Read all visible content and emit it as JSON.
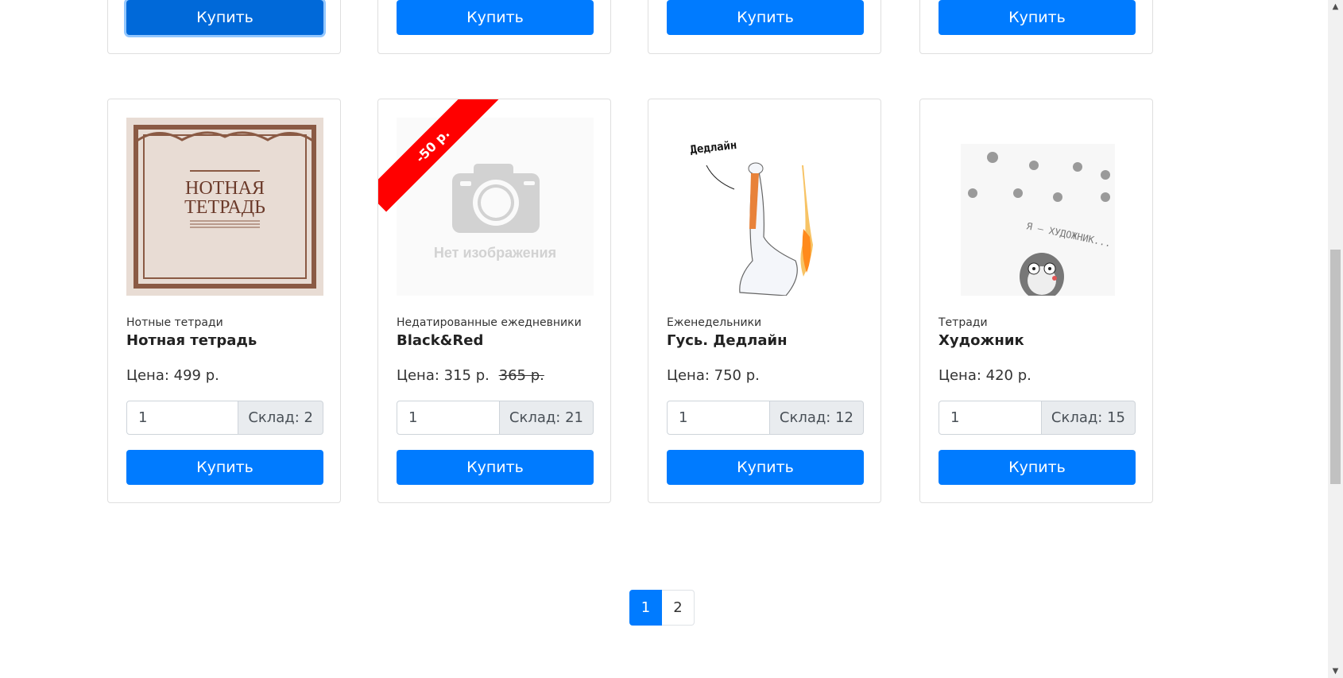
{
  "top_row": {
    "buttons": [
      "Купить",
      "Купить",
      "Купить",
      "Купить"
    ]
  },
  "products": [
    {
      "category": "Нотные тетради",
      "title": "Нотная тетрадь",
      "price_label": "Цена:",
      "price": "499 р.",
      "quantity": "1",
      "stock": "Склад: 2",
      "buy_label": "Купить",
      "cover_text_line1": "НОТНАЯ",
      "cover_text_line2": "ТЕТРАДЬ"
    },
    {
      "category": "Недатированные ежедневники",
      "title": "Black&Red",
      "price_label": "Цена:",
      "price": "315 р.",
      "old_price": "365 р.",
      "discount_badge": "-50 р.",
      "no_image_text": "Нет изображения",
      "quantity": "1",
      "stock": "Склад: 21",
      "buy_label": "Купить"
    },
    {
      "category": "Еженедельники",
      "title": "Гусь. Дедлайн",
      "price_label": "Цена:",
      "price": "750 р.",
      "quantity": "1",
      "stock": "Склад: 12",
      "buy_label": "Купить",
      "cover_caption": "Дедлайн"
    },
    {
      "category": "Тетради",
      "title": "Художник",
      "price_label": "Цена:",
      "price": "420 р.",
      "quantity": "1",
      "stock": "Склад: 15",
      "buy_label": "Купить",
      "cover_caption": "Я — ХУДОЖНИК..."
    }
  ],
  "pagination": {
    "pages": [
      "1",
      "2"
    ],
    "current": "1"
  },
  "colors": {
    "primary": "#007bff",
    "ribbon": "#ff0000",
    "border": "#dee2e6"
  }
}
